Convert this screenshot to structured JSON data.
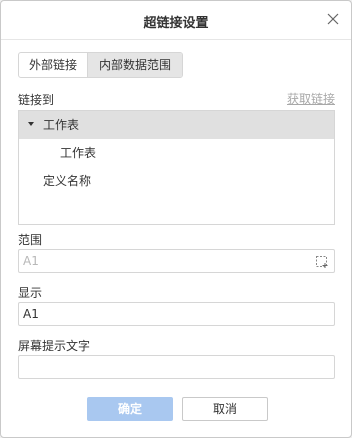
{
  "dialog": {
    "title": "超链接设置",
    "close_icon": "close-icon"
  },
  "tabs": [
    {
      "label": "外部链接",
      "selected": false
    },
    {
      "label": "内部数据范围",
      "selected": true
    }
  ],
  "link_to": {
    "label": "链接到",
    "fetch_link": "获取链接",
    "tree": {
      "root": {
        "label": "工作表",
        "expanded": true,
        "selected": true
      },
      "child": {
        "label": "工作表"
      },
      "other": {
        "label": "定义名称"
      }
    }
  },
  "range": {
    "label": "范围",
    "value": "A1",
    "disabled": true,
    "select_icon": "range-select-icon"
  },
  "display": {
    "label": "显示",
    "value": "A1"
  },
  "tooltip": {
    "label": "屏幕提示文字",
    "value": ""
  },
  "buttons": {
    "ok": "确定",
    "cancel": "取消"
  },
  "colors": {
    "ok_button": "#a9c8f0",
    "selected_row": "#e0e0e0",
    "link_disabled": "#a8a8a8"
  }
}
